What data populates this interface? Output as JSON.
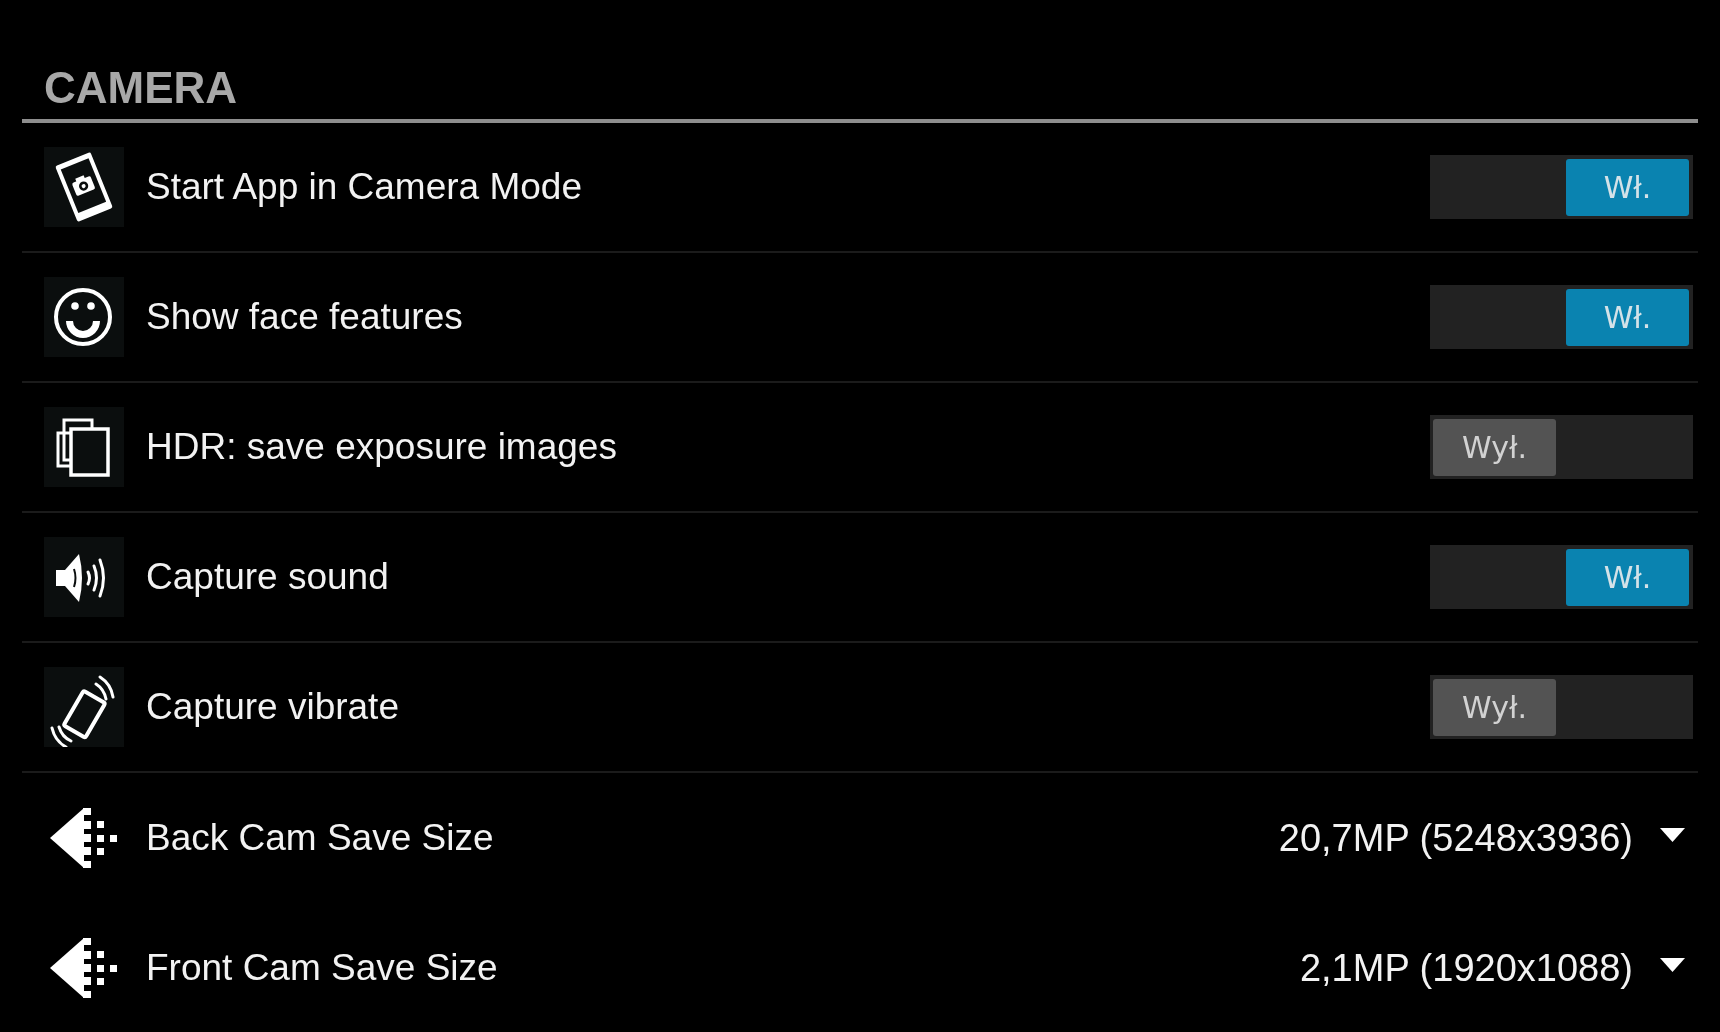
{
  "section": {
    "title": "CAMERA"
  },
  "settings": [
    {
      "kind": "toggle",
      "label": "Start App in Camera Mode",
      "on": true,
      "switch_text": "Wł."
    },
    {
      "kind": "toggle",
      "label": "Show face features",
      "on": true,
      "switch_text": "Wł."
    },
    {
      "kind": "toggle",
      "label": "HDR: save exposure images",
      "on": false,
      "switch_text": "Wył."
    },
    {
      "kind": "toggle",
      "label": "Capture sound",
      "on": true,
      "switch_text": "Wł."
    },
    {
      "kind": "toggle",
      "label": "Capture vibrate",
      "on": false,
      "switch_text": "Wył."
    },
    {
      "kind": "select",
      "label": "Back Cam Save Size",
      "value": "20,7MP (5248x3936)"
    },
    {
      "kind": "select",
      "label": "Front Cam Save Size",
      "value": "2,1MP (1920x1088)"
    }
  ]
}
